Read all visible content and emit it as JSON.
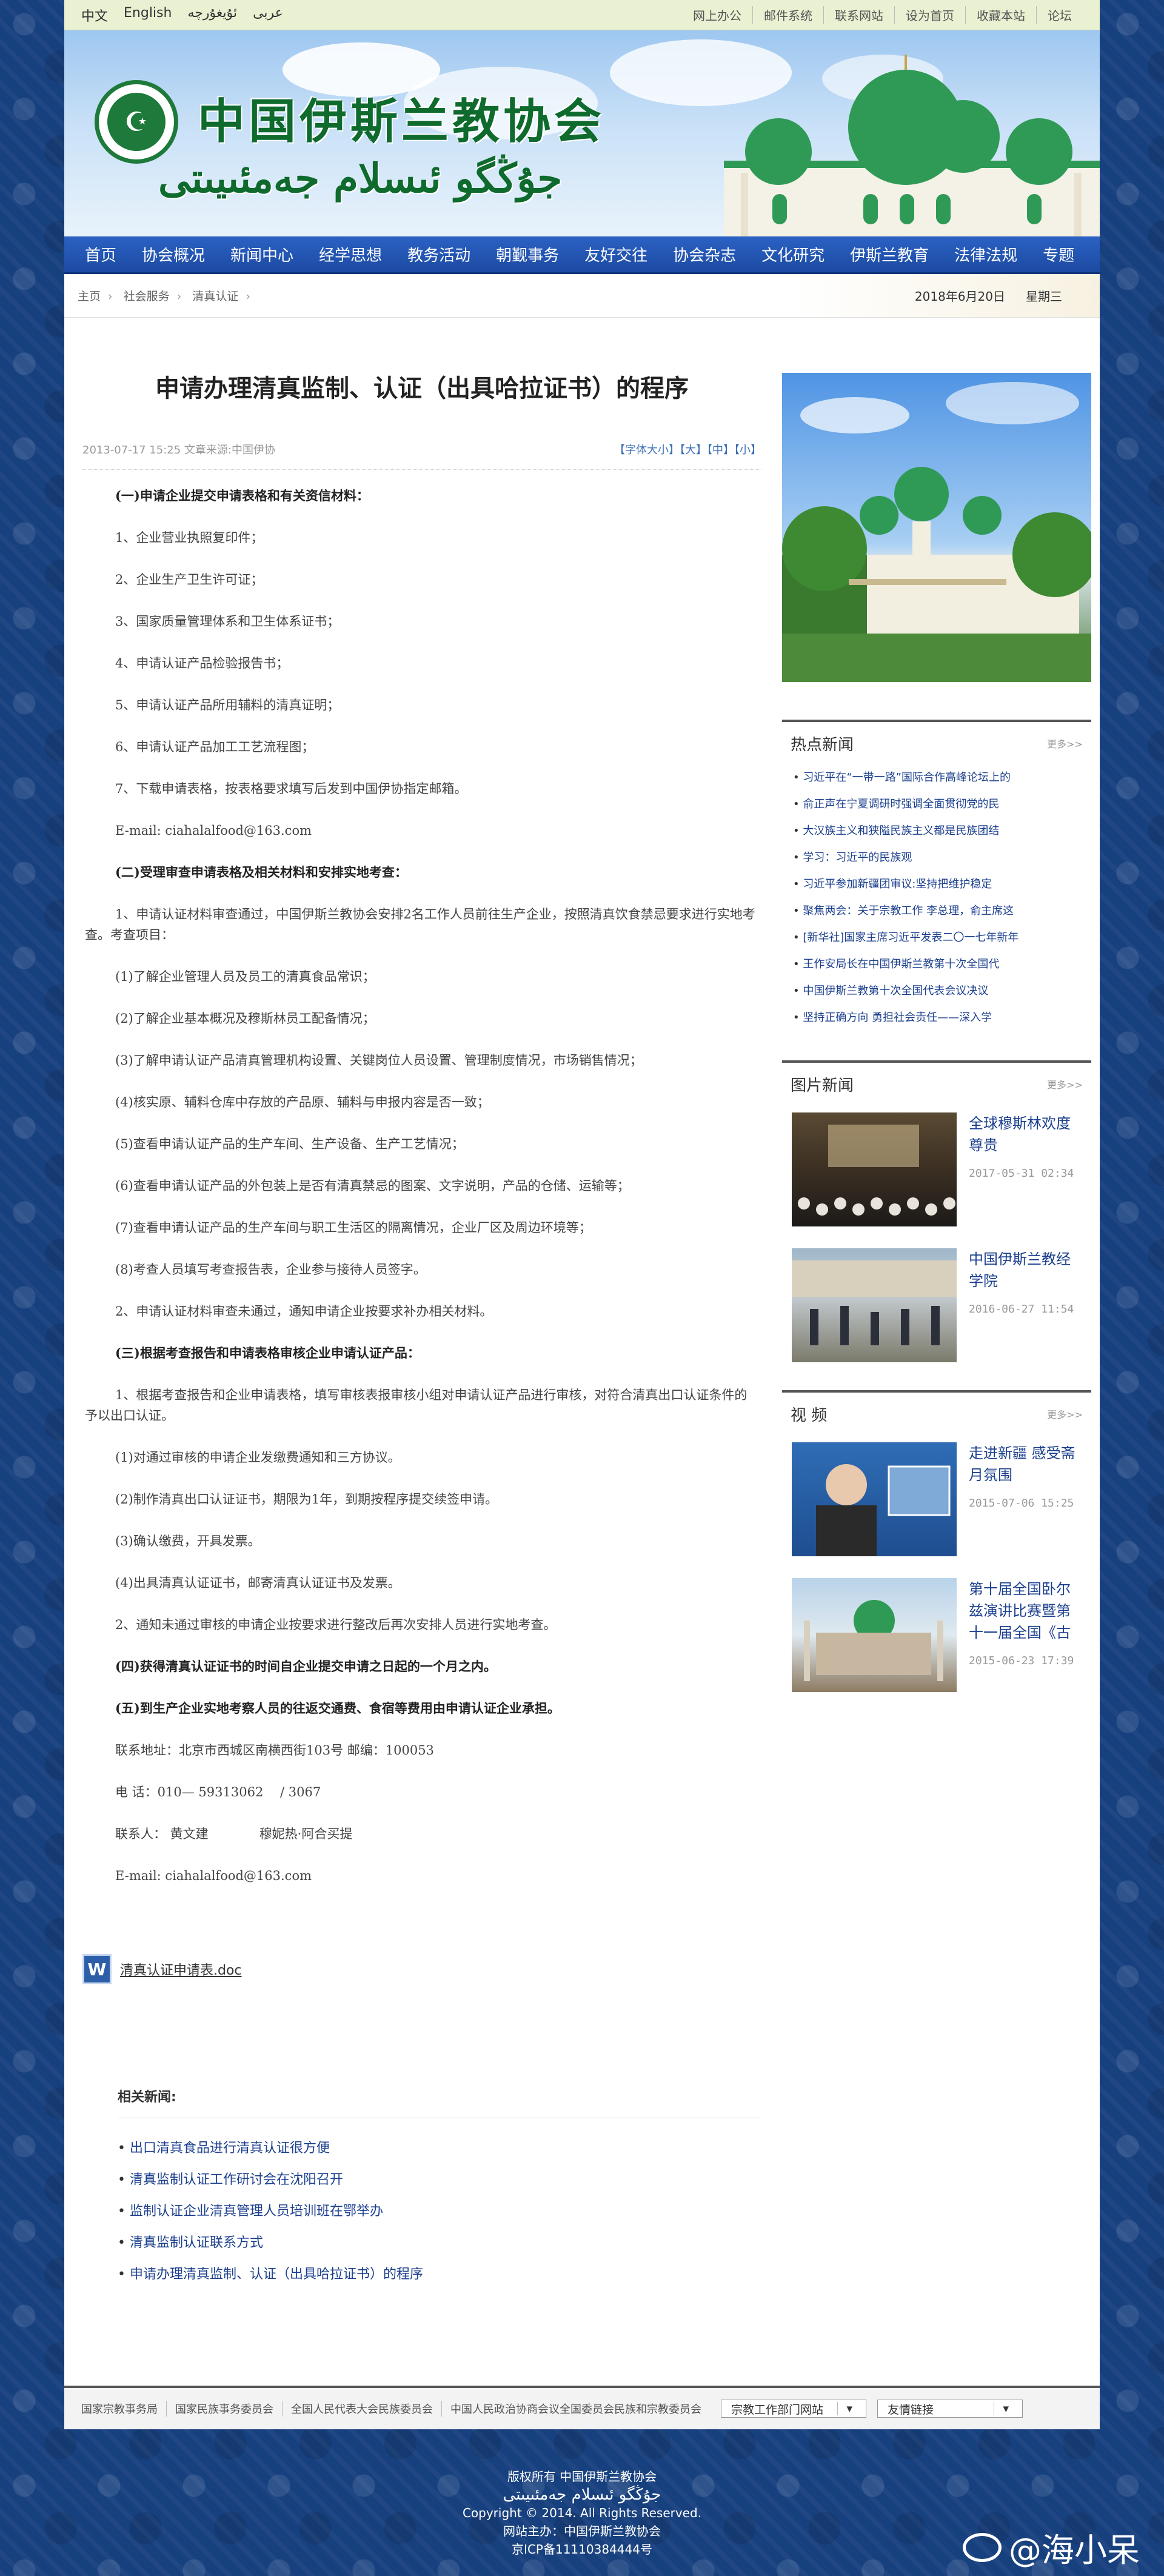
{
  "topbar": {
    "lang": [
      "中文",
      "English",
      "ئۇيغۇرچە",
      "عربى"
    ],
    "links": [
      "网上办公",
      "邮件系统",
      "联系网站",
      "设为首页",
      "收藏本站",
      "论坛"
    ]
  },
  "banner": {
    "title_cn": "中国伊斯兰教协会",
    "title_ug": "جۇڭگو ئىسلام جەمئىيىتى"
  },
  "nav": [
    "首页",
    "协会概况",
    "新闻中心",
    "经学思想",
    "教务活动",
    "朝觐事务",
    "友好交往",
    "协会杂志",
    "文化研究",
    "伊斯兰教育",
    "法律法规",
    "专题"
  ],
  "breadcrumb": {
    "items": [
      "主页",
      "社会服务",
      "清真认证"
    ],
    "date": "2018年6月20日",
    "weekday": "星期三"
  },
  "article": {
    "title": "申请办理清真监制、认证（出具哈拉证书）的程序",
    "meta": "2013-07-17 15:25 文章来源:中国伊协",
    "font_size": "【字体大小】【大】【中】【小】",
    "paragraphs": [
      {
        "bold": true,
        "text": "(一)申请企业提交申请表格和有关资信材料："
      },
      {
        "bold": false,
        "text": "1、企业营业执照复印件；"
      },
      {
        "bold": false,
        "text": "2、企业生产卫生许可证；"
      },
      {
        "bold": false,
        "text": "3、国家质量管理体系和卫生体系证书；"
      },
      {
        "bold": false,
        "text": "4、申请认证产品检验报告书；"
      },
      {
        "bold": false,
        "text": "5、申请认证产品所用辅料的清真证明；"
      },
      {
        "bold": false,
        "text": "6、申请认证产品加工工艺流程图；"
      },
      {
        "bold": false,
        "text": "7、下载申请表格，按表格要求填写后发到中国伊协指定邮箱。"
      },
      {
        "bold": false,
        "text": "E-mail: ciahalalfood@163.com"
      },
      {
        "bold": true,
        "text": "(二)受理审查申请表格及相关材料和安排实地考查："
      },
      {
        "bold": false,
        "text": "1、申请认证材料审查通过，中国伊斯兰教协会安排2名工作人员前往生产企业，按照清真饮食禁忌要求进行实地考查。考查项目："
      },
      {
        "bold": false,
        "text": "(1)了解企业管理人员及员工的清真食品常识；"
      },
      {
        "bold": false,
        "text": "(2)了解企业基本概况及穆斯林员工配备情况；"
      },
      {
        "bold": false,
        "text": "(3)了解申请认证产品清真管理机构设置、关键岗位人员设置、管理制度情况，市场销售情况；"
      },
      {
        "bold": false,
        "text": "(4)核实原、辅料仓库中存放的产品原、辅料与申报内容是否一致；"
      },
      {
        "bold": false,
        "text": "(5)查看申请认证产品的生产车间、生产设备、生产工艺情况；"
      },
      {
        "bold": false,
        "text": "(6)查看申请认证产品的外包装上是否有清真禁忌的图案、文字说明，产品的仓储、运输等；"
      },
      {
        "bold": false,
        "text": "(7)查看申请认证产品的生产车间与职工生活区的隔离情况，企业厂区及周边环境等；"
      },
      {
        "bold": false,
        "text": "(8)考查人员填写考查报告表，企业参与接待人员签字。"
      },
      {
        "bold": false,
        "text": "2、申请认证材料审查未通过，通知申请企业按要求补办相关材料。"
      },
      {
        "bold": true,
        "text": "(三)根据考查报告和申请表格审核企业申请认证产品："
      },
      {
        "bold": false,
        "text": "1、根据考查报告和企业申请表格，填写审核表报审核小组对申请认证产品进行审核，对符合清真出口认证条件的予以出口认证。"
      },
      {
        "bold": false,
        "text": "(1)对通过审核的申请企业发缴费通知和三方协议。"
      },
      {
        "bold": false,
        "text": "(2)制作清真出口认证证书，期限为1年，到期按程序提交续签申请。"
      },
      {
        "bold": false,
        "text": "(3)确认缴费，开具发票。"
      },
      {
        "bold": false,
        "text": "(4)出具清真认证证书，邮寄清真认证证书及发票。"
      },
      {
        "bold": false,
        "text": "2、通知未通过审核的申请企业按要求进行整改后再次安排人员进行实地考查。"
      },
      {
        "bold": true,
        "text": "(四)获得清真认证证书的时间自企业提交申请之日起的一个月之内。"
      },
      {
        "bold": true,
        "text": "(五)到生产企业实地考察人员的往返交通费、食宿等费用由申请认证企业承担。"
      },
      {
        "bold": false,
        "text": "联系地址：北京市西城区南横西街103号 邮编：100053"
      },
      {
        "bold": false,
        "text": "电 话：010— 59313062 　/ 3067"
      },
      {
        "bold": false,
        "text": "联系人： 黄文建　　　　穆妮热·阿合买提"
      },
      {
        "bold": false,
        "text": "E-mail: ciahalalfood@163.com"
      }
    ],
    "attachment": "清真认证申请表.doc",
    "related_title": "相关新闻:",
    "related": [
      "出口清真食品进行清真认证很方便",
      "清真监制认证工作研讨会在沈阳召开",
      "监制认证企业清真管理人员培训班在鄂举办",
      "清真监制认证联系方式",
      "申请办理清真监制、认证（出具哈拉证书）的程序"
    ]
  },
  "sidebar": {
    "more": "更多>>",
    "hot": {
      "title": "热点新闻",
      "items": [
        "习近平在“一带一路”国际合作高峰论坛上的",
        "俞正声在宁夏调研时强调全面贯彻党的民",
        "大汉族主义和狭隘民族主义都是民族团结",
        "学习：习近平的民族观",
        "习近平参加新疆团审议:坚持把维护稳定",
        "聚焦两会：关于宗教工作 李总理，俞主席这",
        "[新华社]国家主席习近平发表二〇一七年新年",
        "王作安局长在中国伊斯兰教第十次全国代",
        "中国伊斯兰教第十次全国代表会议决议",
        "坚持正确方向 勇担社会责任——深入学"
      ]
    },
    "pics": {
      "title": "图片新闻",
      "items": [
        {
          "title": "全球穆斯林欢度尊贵",
          "date": "2017-05-31 02:34"
        },
        {
          "title": "中国伊斯兰教经学院",
          "date": "2016-06-27 11:54"
        }
      ]
    },
    "video": {
      "title": "视 频",
      "items": [
        {
          "title": "走进新疆 感受斋月氛围",
          "date": "2015-07-06 15:25"
        },
        {
          "title": "第十届全国卧尔兹演讲比赛暨第十一届全国《古",
          "date": "2015-06-23 17:39"
        }
      ]
    }
  },
  "footer": {
    "links": [
      "国家宗教事务局",
      "国家民族事务委员会",
      "全国人民代表大会民族委员会",
      "中国人民政治协商会议全国委员会民族和宗教委员会"
    ],
    "select1": "宗教工作部门网站",
    "select2": "友情链接",
    "copyright_line1": "版权所有 中国伊斯兰教协会",
    "copyright_ug": "جۇڭگو ئىسلام جەمئىيىتى",
    "copyright_line2": "Copyright © 2014. All Rights Reserved.",
    "copyright_line3": "网站主办：中国伊斯兰教协会",
    "icp": "京ICP备11110384444号",
    "watermark": "@海小呆"
  },
  "colors": {
    "nav": "#1c4aa2",
    "link": "#1b3f8d",
    "bg": "#17407e",
    "logo_green": "#0e6a2d"
  }
}
